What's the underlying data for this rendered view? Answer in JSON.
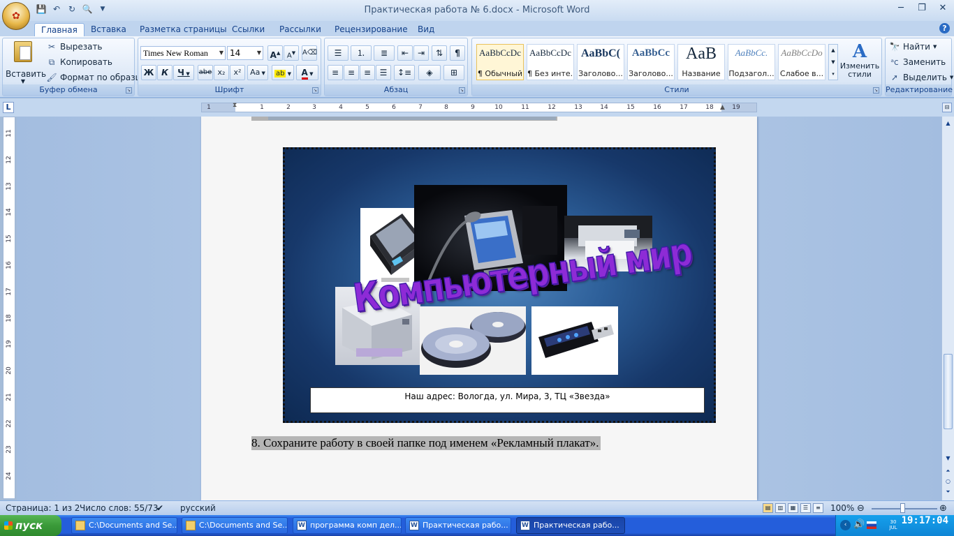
{
  "window": {
    "title": "Практическая работа № 6.docx - Microsoft Word",
    "minimize": "─",
    "restore": "❐",
    "close": "✕"
  },
  "ribbon_tabs": [
    "Главная",
    "Вставка",
    "Разметка страницы",
    "Ссылки",
    "Рассылки",
    "Рецензирование",
    "Вид"
  ],
  "clipboard": {
    "paste": "Вставить",
    "cut": "Вырезать",
    "copy": "Копировать",
    "format_painter": "Формат по образцу",
    "group": "Буфер обмена"
  },
  "font": {
    "name": "Times New Roman",
    "size": "14",
    "group": "Шрифт",
    "bold": "Ж",
    "italic": "К",
    "underline": "Ч",
    "strike": "abe",
    "subscript": "x₂",
    "superscript": "x²",
    "case": "Aa",
    "grow": "A",
    "shrink": "A"
  },
  "paragraph": {
    "group": "Абзац"
  },
  "styles": {
    "group": "Стили",
    "items": [
      {
        "sample": "AaBbCcDc",
        "name": "¶ Обычный"
      },
      {
        "sample": "AaBbCcDc",
        "name": "¶ Без инте..."
      },
      {
        "sample": "AaBbC(",
        "name": "Заголово..."
      },
      {
        "sample": "AaBbCc",
        "name": "Заголово..."
      },
      {
        "sample": "AaB",
        "name": "Название"
      },
      {
        "sample": "AaBbCc.",
        "name": "Подзагол..."
      },
      {
        "sample": "AaBbCcDo",
        "name": "Слабое в..."
      }
    ],
    "change": "Изменить стили"
  },
  "editing": {
    "group": "Редактирование",
    "find": "Найти",
    "replace": "Заменить",
    "select": "Выделить"
  },
  "ruler": {
    "h_ticks": [
      "1",
      "1",
      "2",
      "3",
      "4",
      "5",
      "6",
      "7",
      "8",
      "9",
      "10",
      "11",
      "12",
      "13",
      "14",
      "15",
      "16",
      "17",
      "18",
      "19"
    ],
    "v_ticks": [
      "11",
      "12",
      "13",
      "14",
      "15",
      "16",
      "17",
      "18",
      "19",
      "20",
      "21",
      "22",
      "23",
      "24"
    ],
    "corner": "L"
  },
  "document": {
    "wordart": "Компьютерный мир",
    "address": "Наш адрес: Вологда, ул. Мира, 3, ТЦ «Звезда»",
    "step8": "8.   Сохраните работу в своей папке под именем «Рекламный плакат»."
  },
  "status": {
    "page": "Страница: 1 из 2",
    "words": "Число слов: 55/73",
    "lang": "русский",
    "zoom": "100%"
  },
  "taskbar": {
    "start": "пуск",
    "tasks": [
      {
        "label": "C:\\Documents and Se...",
        "icon": "folder-icon"
      },
      {
        "label": "C:\\Documents and Se...",
        "icon": "folder-icon"
      },
      {
        "label": "программа комп дел...",
        "icon": "word-icon"
      },
      {
        "label": "Практическая рабо...",
        "icon": "word-icon"
      },
      {
        "label": "Практическая рабо...",
        "icon": "word-icon"
      }
    ],
    "time": "19:17:04",
    "date_top": "30",
    "date_bottom": "JUL"
  }
}
